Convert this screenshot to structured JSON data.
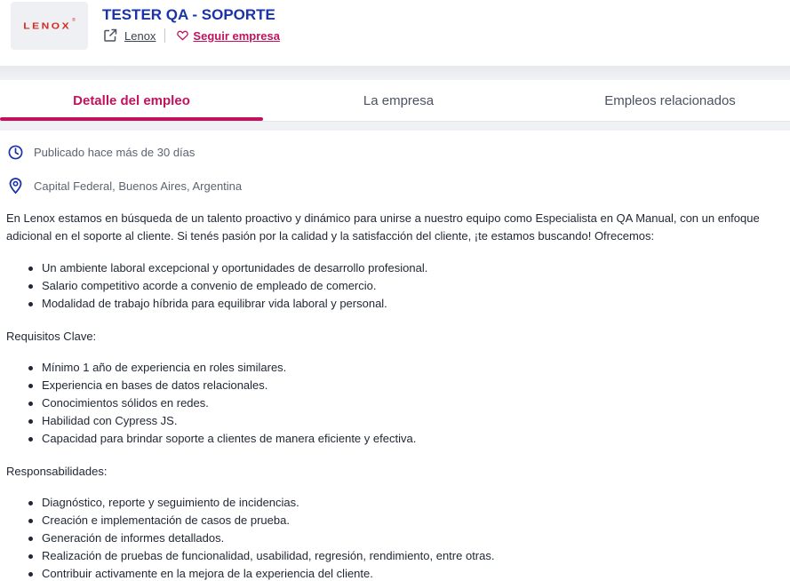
{
  "header": {
    "logo_text": "LENOX",
    "title": "TESTER QA - SOPORTE",
    "company": "Lenox",
    "follow": "Seguir empresa"
  },
  "tabs": [
    {
      "label": "Detalle del empleo",
      "active": true
    },
    {
      "label": "La empresa",
      "active": false
    },
    {
      "label": "Empleos relacionados",
      "active": false
    }
  ],
  "info": {
    "published": "Publicado hace más de 30 días",
    "location": "Capital Federal, Buenos Aires, Argentina"
  },
  "description": {
    "intro": "En Lenox estamos en búsqueda de un talento proactivo y dinámico para unirse a nuestro equipo como Especialista en QA Manual, con un enfoque adicional en el soporte al cliente. Si tenés pasión por la calidad y la satisfacción del cliente, ¡te estamos buscando! Ofrecemos:",
    "offers": [
      "Un ambiente laboral excepcional y oportunidades de desarrollo profesional.",
      "Salario competitivo acorde a convenio de empleado de comercio.",
      "Modalidad de trabajo híbrida para equilibrar vida laboral y personal."
    ],
    "requirements_label": "Requisitos Clave:",
    "requirements": [
      "Mínimo 1 año de experiencia en roles similares.",
      "Experiencia en bases de datos relacionales.",
      "Conocimientos sólidos en redes.",
      "Habilidad con Cypress JS.",
      "Capacidad para brindar soporte a clientes de manera eficiente y efectiva."
    ],
    "responsibilities_label": "Responsabilidades:",
    "responsibilities": [
      "Diagnóstico, reporte y seguimiento de incidencias.",
      "Creación e implementación de casos de prueba.",
      "Generación de informes detallados.",
      "Realización de pruebas de funcionalidad, usabilidad, regresión, rendimiento, entre otras.",
      "Contribuir activamente en la mejora de la experiencia del cliente."
    ]
  },
  "colors": {
    "title_blue": "#1a33a8",
    "accent_pink": "#c0135f",
    "icon_blue": "#1a33a8",
    "logo_red": "#d52b1e"
  },
  "icons": {
    "company": "external-link-icon",
    "follow": "heart-icon",
    "published": "clock-icon",
    "location": "map-pin-icon"
  }
}
